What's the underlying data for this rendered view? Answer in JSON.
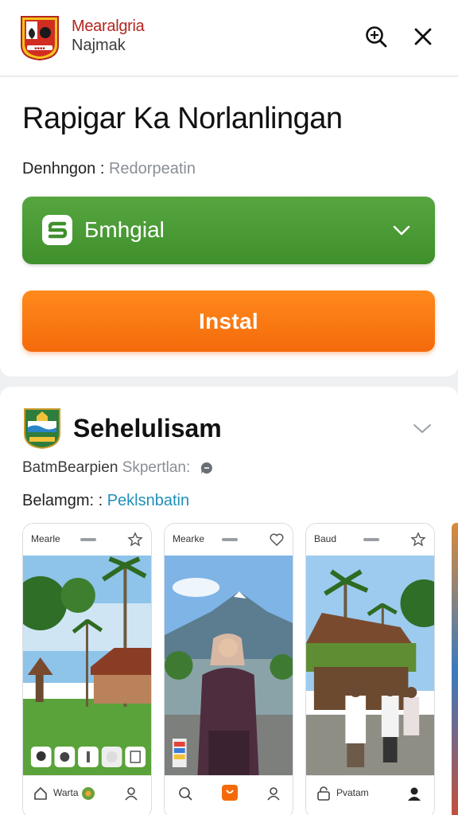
{
  "header": {
    "brand_line1": "Mearalgria",
    "brand_line2": "Najmak",
    "logo_icon": "flag-crest-icon",
    "search_icon": "search-icon",
    "close_icon": "close-icon"
  },
  "main": {
    "title": "Rapigar Ka Norlanlingan",
    "meta_label": "Denhngon :",
    "meta_value": "Redorpeatin",
    "select": {
      "icon": "app-badge-icon",
      "label": "Бmhgial"
    },
    "install_label": "Instal"
  },
  "section": {
    "name": "Sehelulisam",
    "row1_label": "BatmBearpien",
    "row1_value": "Skpertlan:",
    "row2_label": "Belamgm: :",
    "row2_link": "Peklsnbatin"
  },
  "screens": [
    {
      "top_label": "Mearle",
      "bottom_label": "Warta",
      "top_icon": "star-icon"
    },
    {
      "top_label": "Mearke",
      "bottom_label": "",
      "top_icon": "heart-icon"
    },
    {
      "top_label": "Baud",
      "bottom_label": "Pvatam",
      "top_icon": "share-icon"
    }
  ],
  "colors": {
    "green": "#4a9a36",
    "orange": "#f57a12",
    "link": "#1f8fb8",
    "brand_red": "#b3261e"
  }
}
